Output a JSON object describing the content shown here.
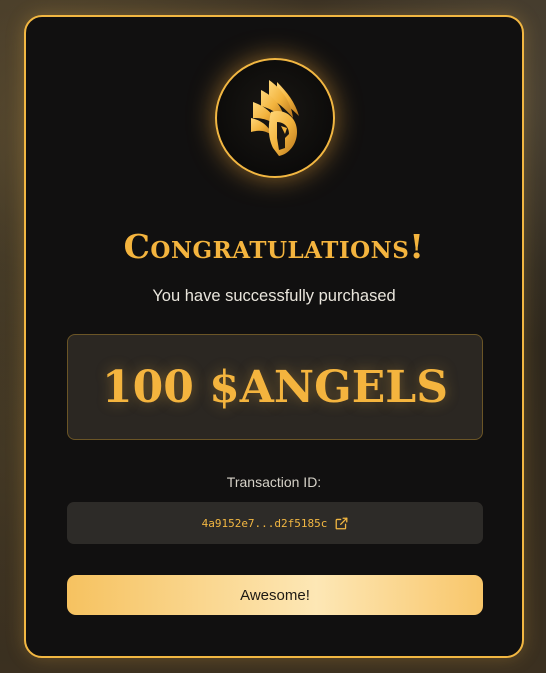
{
  "dialog": {
    "logo_icon": "winged-helmet-logo-icon",
    "title": "Congratulations!",
    "subtitle": "You have successfully purchased",
    "amount": "100 $ANGELS",
    "transaction_label": "Transaction ID:",
    "transaction_id": "4a9152e7...d2f5185c",
    "external_link_icon": "external-link-icon",
    "confirm_label": "Awesome!"
  },
  "colors": {
    "accent": "#f2b742",
    "card_background": "#111010",
    "amount_box_background": "#2b2722",
    "tx_box_background": "#2d2b28",
    "button_gradient_light": "#fde7b5"
  }
}
